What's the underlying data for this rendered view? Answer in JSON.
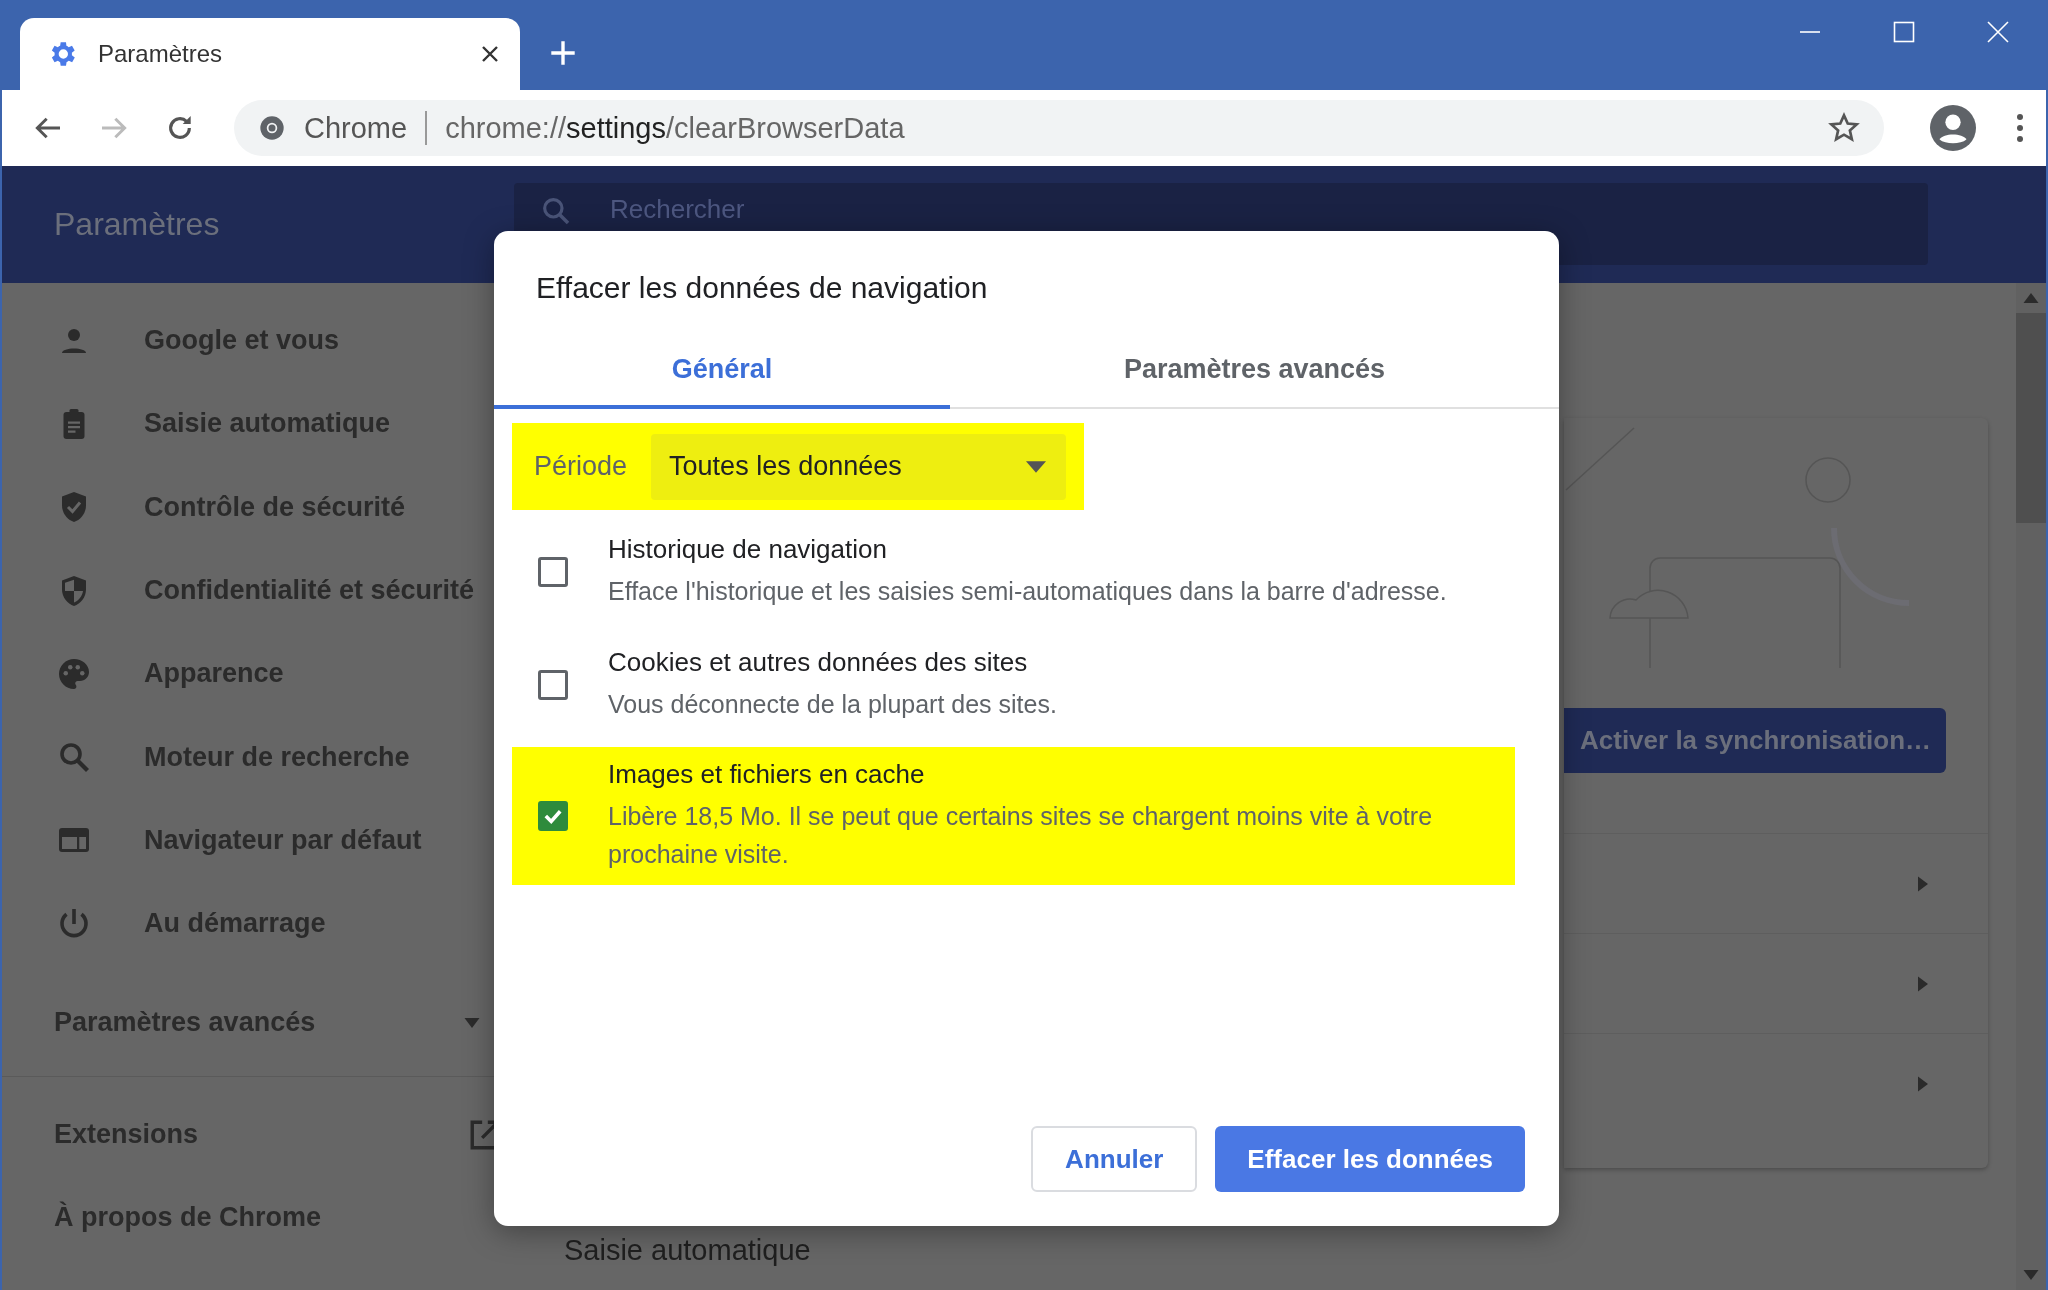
{
  "browser": {
    "tab": {
      "title": "Paramètres"
    },
    "omnibox": {
      "site": "Chrome",
      "url": {
        "scheme": "chrome://",
        "host": "settings",
        "path": "/clearBrowserData"
      }
    }
  },
  "settings": {
    "title": "Paramètres",
    "search": {
      "placeholder": "Rechercher"
    },
    "sidebar": {
      "items": [
        {
          "label": "Google et vous"
        },
        {
          "label": "Saisie automatique"
        },
        {
          "label": "Contrôle de sécurité"
        },
        {
          "label": "Confidentialité et sécurité"
        },
        {
          "label": "Apparence"
        },
        {
          "label": "Moteur de recherche"
        },
        {
          "label": "Navigateur par défaut"
        },
        {
          "label": "Au démarrage"
        }
      ],
      "advanced": {
        "label": "Paramètres avancés",
        "expanded": false
      },
      "links": [
        {
          "label": "Extensions",
          "external": true
        },
        {
          "label": "À propos de Chrome",
          "external": false
        }
      ]
    },
    "sync_button": "Activer la synchronisation…",
    "section_heading": "Saisie automatique"
  },
  "dialog": {
    "title": "Effacer les données de navigation",
    "tabs": [
      {
        "label": "Général",
        "selected": true
      },
      {
        "label": "Paramètres avancés",
        "selected": false
      }
    ],
    "period": {
      "label": "Période",
      "value": "Toutes les données",
      "highlighted": true
    },
    "items": [
      {
        "title": "Historique de navigation",
        "description": "Efface l'historique et les saisies semi-automatiques dans la barre d'adresse.",
        "checked": false,
        "highlighted": false
      },
      {
        "title": "Cookies et autres données des sites",
        "description": "Vous déconnecte de la plupart des sites.",
        "checked": false,
        "highlighted": false
      },
      {
        "title": "Images et fichiers en cache",
        "description": "Libère 18,5 Mo. Il se peut que certains sites se chargent moins vite à votre prochaine visite.",
        "checked": true,
        "highlighted": true
      }
    ],
    "buttons": [
      {
        "label": "Annuler",
        "kind": "secondary"
      },
      {
        "label": "Effacer les données",
        "kind": "primary"
      }
    ]
  }
}
